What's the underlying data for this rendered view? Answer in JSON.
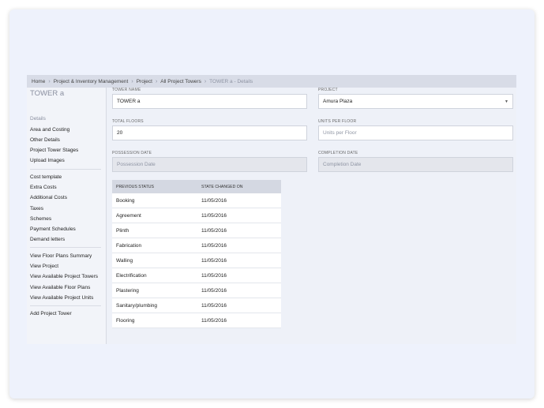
{
  "breadcrumb": {
    "items": [
      "Home",
      "Project & Inventory Management",
      "Project",
      "All Project Towers"
    ],
    "current": "TOWER a - Details"
  },
  "sidebar": {
    "title": "TOWER a",
    "group1": [
      "Details",
      "Area and Costing",
      "Other Details",
      "Project Tower Stages",
      "Upload Images"
    ],
    "group2": [
      "Cost template",
      "Extra Costs",
      "Additional Costs",
      "Taxes",
      "Schemes",
      "Payment Schedules",
      "Demand letters"
    ],
    "group3": [
      "View Floor Plans Summary",
      "View Project",
      "View Available Project Towers",
      "View Available Floor Plans",
      "View Available Project Units"
    ],
    "group4": [
      "Add Project Tower"
    ]
  },
  "form": {
    "tower_name_label": "TOWER NAME",
    "tower_name_value": "TOWER a",
    "project_label": "PROJECT",
    "project_value": "Amura Plaza",
    "total_floors_label": "TOTAL FLOORS",
    "total_floors_value": "20",
    "units_per_floor_label": "UNITS PER FLOOR",
    "units_per_floor_placeholder": "Units per Floor",
    "possession_date_label": "POSSESSION DATE",
    "possession_date_placeholder": "Possession Date",
    "completion_date_label": "COMPLETION DATE",
    "completion_date_placeholder": "Completion Date"
  },
  "status_table": {
    "headers": [
      "PREVIOUS STATUS",
      "STATE CHANGED ON"
    ],
    "rows": [
      [
        "Booking",
        "11/05/2016"
      ],
      [
        "Agreement",
        "11/05/2016"
      ],
      [
        "Plinth",
        "11/05/2016"
      ],
      [
        "Fabrication",
        "11/05/2016"
      ],
      [
        "Walling",
        "11/05/2016"
      ],
      [
        "Electrification",
        "11/05/2016"
      ],
      [
        "Plastering",
        "11/05/2016"
      ],
      [
        "Sanitary/plumbing",
        "11/05/2016"
      ],
      [
        "Flooring",
        "11/05/2016"
      ]
    ]
  },
  "icons": {
    "breadcrumb_separator": "chevron-right-icon",
    "select_caret": "caret-down-icon"
  }
}
